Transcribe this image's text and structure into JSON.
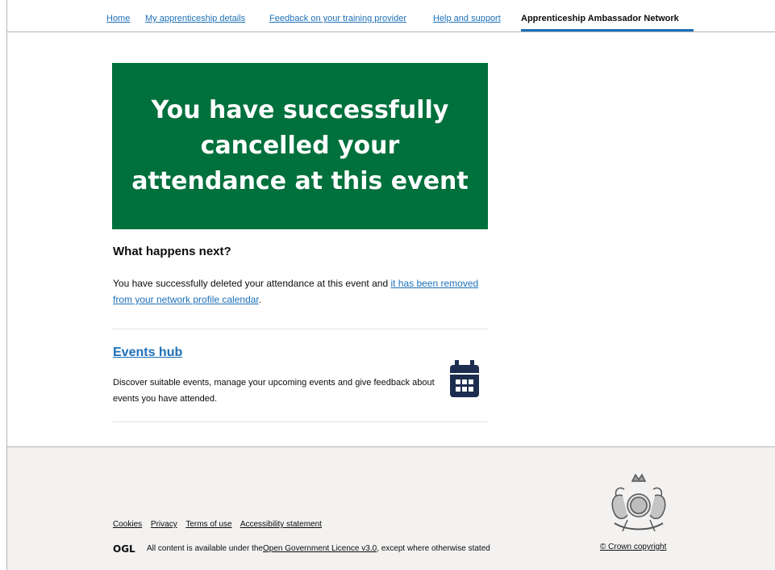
{
  "nav": {
    "items": [
      {
        "label": "Home"
      },
      {
        "label": "My apprenticeship details"
      },
      {
        "label": "Feedback on your training provider"
      },
      {
        "label": "Help and support"
      },
      {
        "label": "Apprenticeship Ambassador Network"
      }
    ],
    "active": "Apprenticeship Ambassador Network"
  },
  "panel": {
    "title": "You have successfully cancelled your attendance at this event",
    "color": "#00703c"
  },
  "next": {
    "heading": "What happens next?",
    "text_before": "You have successfully deleted your attendance at this event and ",
    "link": "it has been removed from your network profile calendar",
    "text_after": "."
  },
  "events_hub": {
    "title": "Events hub",
    "description": "Discover suitable events, manage your upcoming events and give feedback about events you have attended.",
    "icon": "calendar-icon"
  },
  "footer": {
    "links": [
      "Cookies",
      "Privacy",
      "Terms of use",
      "Accessibility statement"
    ],
    "ogl_logo": "OGL",
    "licence_before": "All content is available under the ",
    "licence_link": "Open Government Licence v3.0",
    "licence_after": ", except where otherwise stated",
    "copyright": "© Crown copyright",
    "crest_icon": "royal-coat-of-arms-icon"
  },
  "colors": {
    "link": "#1d70b8",
    "success_panel": "#00703c",
    "footer_bg": "#f3f2f1",
    "icon": "#1d2d50"
  }
}
